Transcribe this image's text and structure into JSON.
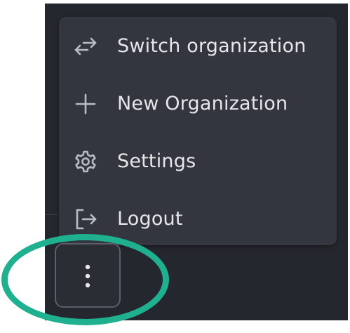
{
  "menu": {
    "items": [
      {
        "label": "Switch organization",
        "icon": "switch-arrows-icon"
      },
      {
        "label": "New Organization",
        "icon": "plus-icon"
      },
      {
        "label": "Settings",
        "icon": "gear-icon"
      },
      {
        "label": "Logout",
        "icon": "logout-icon"
      }
    ]
  },
  "more_button": {
    "icon": "vertical-ellipsis-icon"
  },
  "annotation": {
    "shape": "ellipse",
    "color": "#1fb08f"
  },
  "colors": {
    "panel_bg": "#25272e",
    "menu_bg": "#33363e",
    "text": "#e6e7ea",
    "icon": "#b9bcc4",
    "highlight": "#1fb08f"
  }
}
